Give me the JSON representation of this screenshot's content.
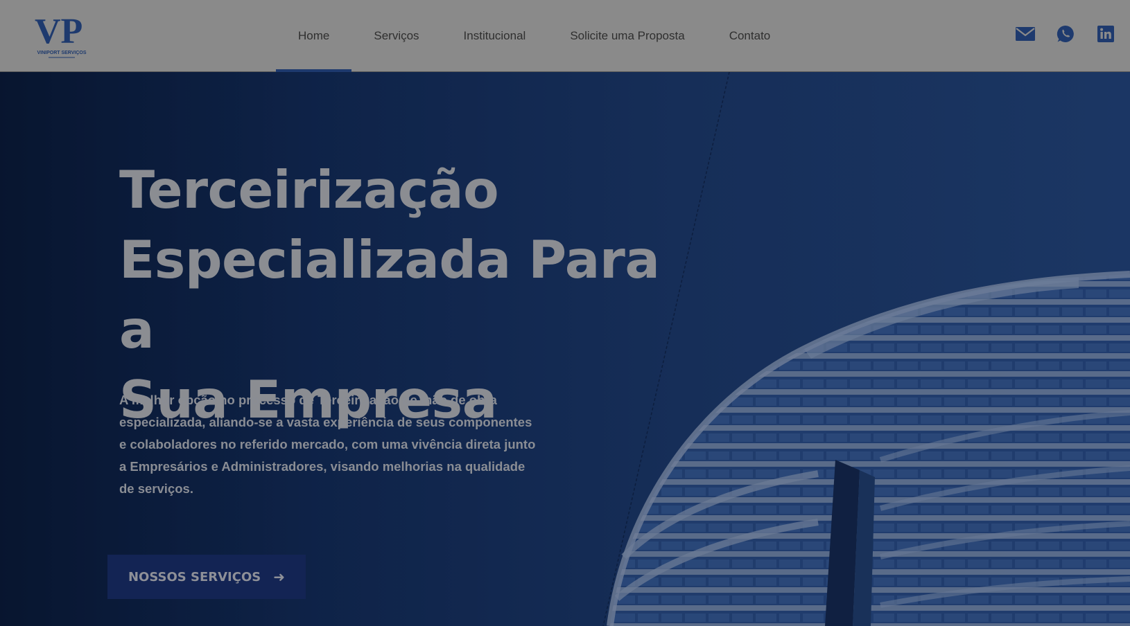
{
  "brand": {
    "logo_letters": "VP",
    "logo_subtitle": "VINIPORT SERVIÇOS"
  },
  "nav": {
    "items": [
      {
        "label": "Home",
        "active": true
      },
      {
        "label": "Serviços",
        "active": false
      },
      {
        "label": "Institucional",
        "active": false
      },
      {
        "label": "Solicite uma Proposta",
        "active": false
      },
      {
        "label": "Contato",
        "active": false
      }
    ]
  },
  "social": {
    "icons": [
      "mail-icon",
      "whatsapp-icon",
      "linkedin-icon"
    ]
  },
  "hero": {
    "headline_line1": "Terceirização",
    "headline_line2": "Especializada Para a",
    "headline_line3": "Sua Empresa",
    "paragraph": "A melhor opção no processo de Terceirização de mão de obra especializada, aliando-se a vasta experiência de seus componentes e colaboladores no referido mercado, com uma vivência direta junto a Empresários e Administradores, visando melhorias na qualidade de serviços.",
    "cta_label": "NOSSOS SERVIÇOS",
    "cta_icon": "arrow-right-icon"
  },
  "colors": {
    "header_bg": "#8a8a8a",
    "brand_blue": "#1e3a6e",
    "hero_bg": "#122a56",
    "cta_bg": "#132454"
  }
}
